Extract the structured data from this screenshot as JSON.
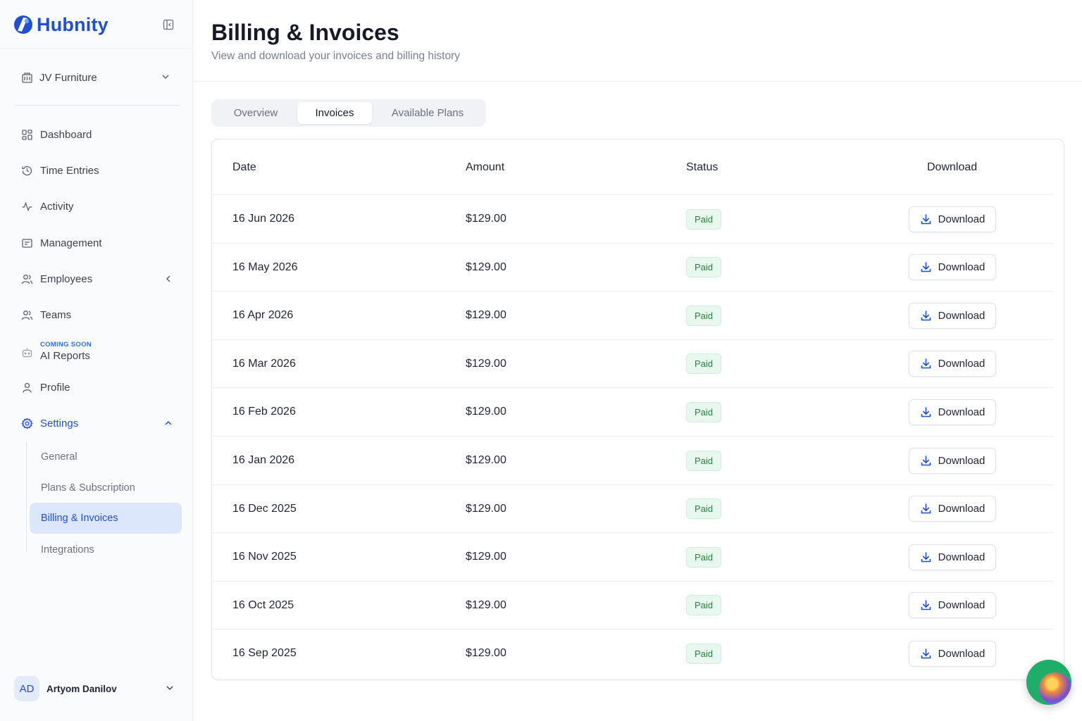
{
  "brand": {
    "name": "Hubnity"
  },
  "sidebar": {
    "workspace": "JV Furniture",
    "nav": [
      {
        "label": "Dashboard",
        "icon": "grid-icon"
      },
      {
        "label": "Time Entries",
        "icon": "history-icon"
      },
      {
        "label": "Activity",
        "icon": "activity-icon"
      },
      {
        "label": "Management",
        "icon": "folder-icon"
      },
      {
        "label": "Employees",
        "icon": "users-icon"
      },
      {
        "label": "Teams",
        "icon": "team-icon"
      },
      {
        "label": "AI Reports",
        "badge": "COMING SOON",
        "icon": "robot-icon"
      },
      {
        "label": "Profile",
        "icon": "user-icon"
      },
      {
        "label": "Settings",
        "icon": "gear-icon"
      }
    ],
    "settings_sub": [
      {
        "label": "General"
      },
      {
        "label": "Plans & Subscription"
      },
      {
        "label": "Billing & Invoices",
        "active": true
      },
      {
        "label": "Integrations"
      }
    ],
    "user": {
      "initials": "AD",
      "name": "Artyom Danilov"
    }
  },
  "header": {
    "title": "Billing & Invoices",
    "subtitle": "View and download your invoices and billing history"
  },
  "tabs": [
    "Overview",
    "Invoices",
    "Available Plans"
  ],
  "active_tab": "Invoices",
  "table": {
    "columns": [
      "Date",
      "Amount",
      "Status",
      "Download"
    ],
    "rows": [
      {
        "date": "16 Jun 2026",
        "amount": "$129.00",
        "status": "Paid",
        "action": "Download"
      },
      {
        "date": "16 May 2026",
        "amount": "$129.00",
        "status": "Paid",
        "action": "Download"
      },
      {
        "date": "16 Apr 2026",
        "amount": "$129.00",
        "status": "Paid",
        "action": "Download"
      },
      {
        "date": "16 Mar 2026",
        "amount": "$129.00",
        "status": "Paid",
        "action": "Download"
      },
      {
        "date": "16 Feb 2026",
        "amount": "$129.00",
        "status": "Paid",
        "action": "Download"
      },
      {
        "date": "16 Jan 2026",
        "amount": "$129.00",
        "status": "Paid",
        "action": "Download"
      },
      {
        "date": "16 Dec 2025",
        "amount": "$129.00",
        "status": "Paid",
        "action": "Download"
      },
      {
        "date": "16 Nov 2025",
        "amount": "$129.00",
        "status": "Paid",
        "action": "Download"
      },
      {
        "date": "16 Oct 2025",
        "amount": "$129.00",
        "status": "Paid",
        "action": "Download"
      },
      {
        "date": "16 Sep 2025",
        "amount": "$129.00",
        "status": "Paid",
        "action": "Download"
      }
    ]
  },
  "colors": {
    "brand": "#1f4fd6",
    "status_paid_bg": "#e9f8ee",
    "status_paid_text": "#23843f",
    "active_nav_bg": "#dde7fb"
  }
}
